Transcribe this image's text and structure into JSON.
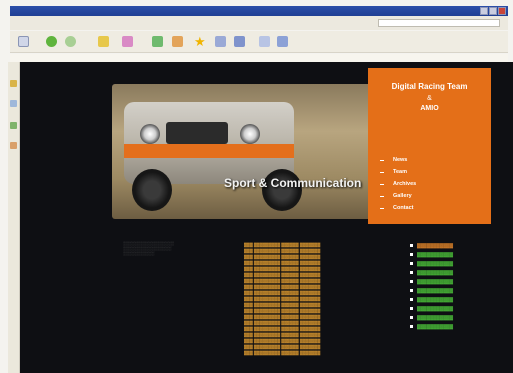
{
  "menu": [
    "",
    "",
    "",
    "",
    "",
    "",
    "",
    "",
    "",
    "",
    "",
    ""
  ],
  "toolbar_icons": [
    "page-icon",
    "back-icon",
    "forward-icon",
    "edit-icon",
    "cut-icon",
    "copy-icon",
    "paste-icon",
    "star-icon",
    "table-icon",
    "layout-icon",
    "link-icon",
    "grid-icon"
  ],
  "site": {
    "hero": {
      "title": "Sport & Communication",
      "subtitle": ""
    },
    "panel": {
      "title": "Digital Racing Team",
      "amp": "&",
      "subtitle": "AMIO",
      "desc": "",
      "nav": [
        "News",
        "Team",
        "Archives",
        "Gallery",
        "Contact"
      ]
    },
    "col1": {
      "head": "",
      "links": [
        "",
        "",
        "",
        "",
        ""
      ]
    },
    "col2": {
      "head": ""
    },
    "col3": {
      "head": ""
    }
  },
  "colors": {
    "accent_orange": "#e46f18",
    "heading_green": "#4cc23a",
    "link_orange": "#e2862a",
    "background": "#0e0f13"
  }
}
